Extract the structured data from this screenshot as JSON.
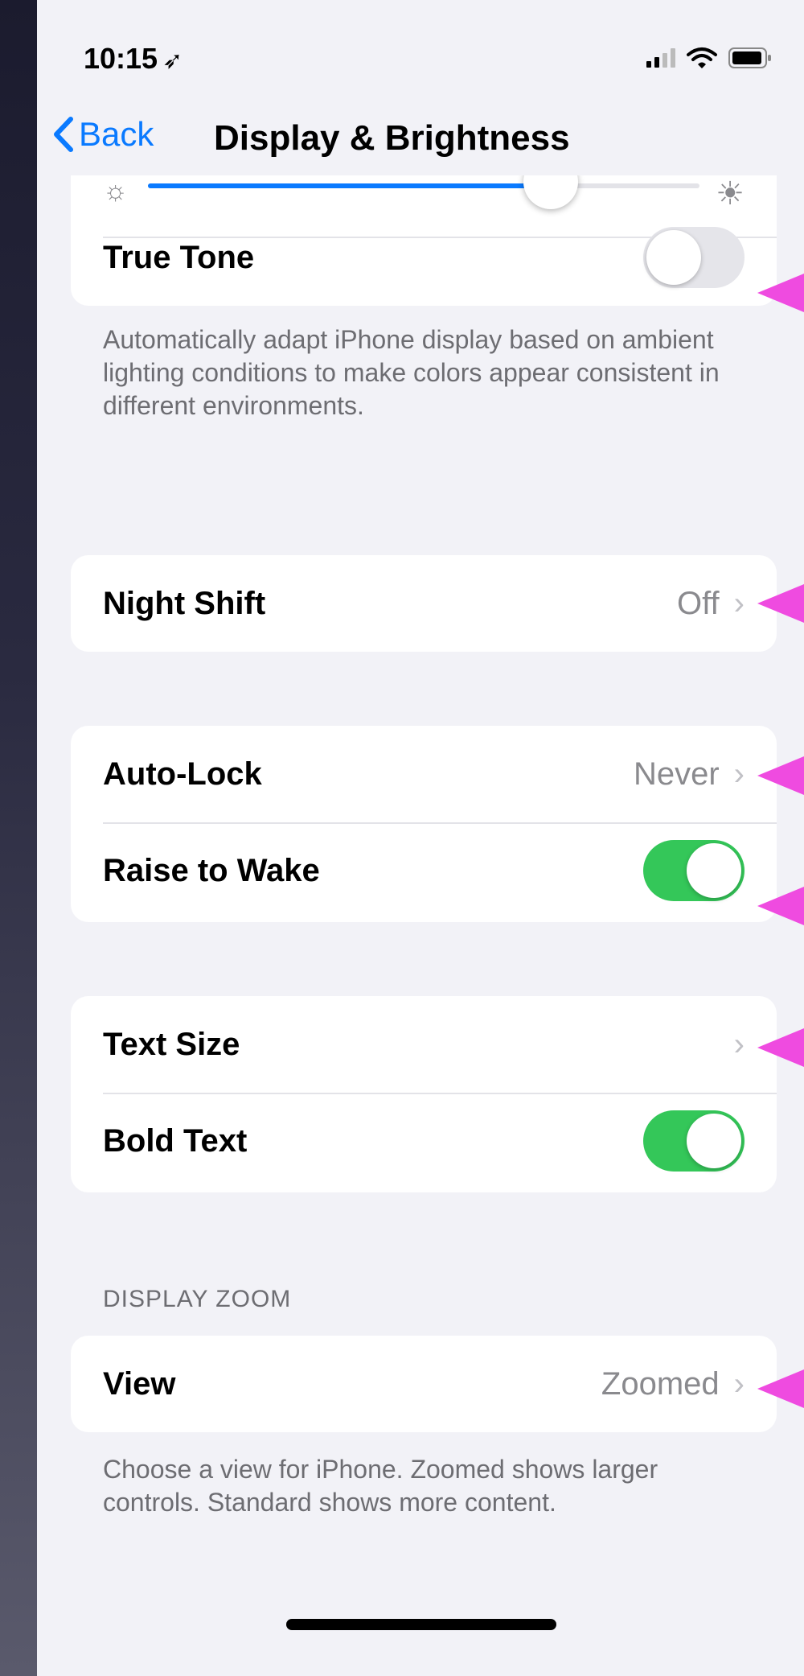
{
  "status_bar": {
    "time": "10:15"
  },
  "nav": {
    "back_label": "Back",
    "title": "Display & Brightness"
  },
  "brightness": {
    "level": 0.73
  },
  "true_tone": {
    "label": "True Tone",
    "enabled": false,
    "footer": "Automatically adapt iPhone display based on ambient lighting conditions to make colors appear consistent in different environments."
  },
  "night_shift": {
    "label": "Night Shift",
    "value": "Off"
  },
  "auto_lock": {
    "label": "Auto-Lock",
    "value": "Never"
  },
  "raise_to_wake": {
    "label": "Raise to Wake",
    "enabled": true
  },
  "text_size": {
    "label": "Text Size"
  },
  "bold_text": {
    "label": "Bold Text",
    "enabled": true
  },
  "display_zoom": {
    "header": "DISPLAY ZOOM",
    "view_label": "View",
    "view_value": "Zoomed",
    "footer": "Choose a view for iPhone. Zoomed shows larger controls. Standard shows more content."
  },
  "colors": {
    "accent": "#0a7aff",
    "toggle_on": "#34c759",
    "annotation_arrow": "#ef4be0"
  }
}
